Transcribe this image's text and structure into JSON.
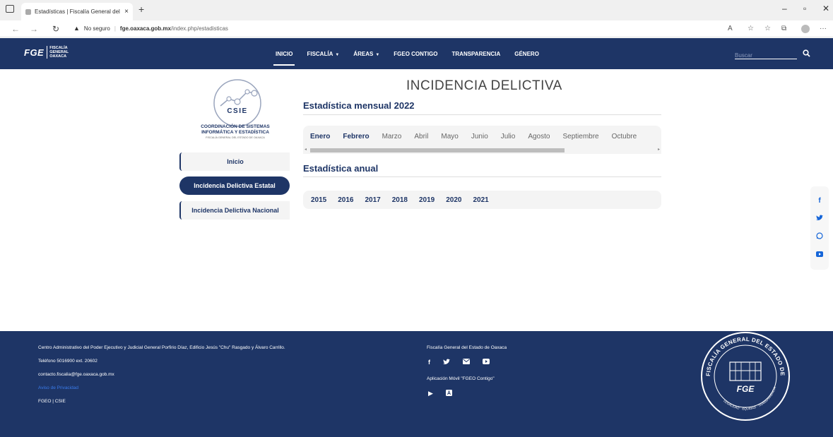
{
  "browser": {
    "tab_title": "Estadísticas | Fiscalía General del",
    "tab_close": "×",
    "new_tab": "+",
    "url_warning": "No seguro",
    "url_host": "fge.oaxaca.gob.mx",
    "url_path": "/index.php/estadisticas"
  },
  "header": {
    "logo_big": "FGE",
    "logo_small_1": "FISCALÍA",
    "logo_small_2": "GENERAL",
    "logo_small_3": "OAXACA",
    "nav": [
      {
        "label": "INICIO"
      },
      {
        "label": "FISCALÍA"
      },
      {
        "label": "ÁREAS"
      },
      {
        "label": "FGEO CONTIGO"
      },
      {
        "label": "TRANSPARENCIA"
      },
      {
        "label": "GÉNERO"
      }
    ],
    "search_placeholder": "Buscar"
  },
  "sidebar": {
    "logo_text": "CSIE",
    "title_1": "COORDINACIÓN DE SISTEMAS",
    "title_2": "INFORMÁTICA Y ESTADÍSTICA",
    "subtitle": "FISCALÍA GENERAL DEL ESTADO DE OAXACA",
    "items": [
      {
        "label": "Inicio"
      },
      {
        "label": "Incidencia Delictiva Estatal"
      },
      {
        "label": "Incidencia Delictiva Nacional"
      }
    ]
  },
  "main": {
    "title": "INCIDENCIA DELICTIVA",
    "monthly_title": "Estadística mensual 2022",
    "months": [
      "Enero",
      "Febrero",
      "Marzo",
      "Abril",
      "Mayo",
      "Junio",
      "Julio",
      "Agosto",
      "Septiembre",
      "Octubre"
    ],
    "annual_title": "Estadística anual",
    "years": [
      "2015",
      "2016",
      "2017",
      "2018",
      "2019",
      "2020",
      "2021"
    ]
  },
  "social": {
    "facebook": "f",
    "twitter": "🐦",
    "whatsapp": "☏",
    "youtube": "▶"
  },
  "footer": {
    "address": "Centro Administrativo del Poder Ejecutivo y Judicial General Porfirio Díaz, Edificio Jesús \"Chu\" Rasgado y Álvaro Carrillo.",
    "phone": "Teléfono 5016900 ext. 20602",
    "email": "contacto.fiscalia@fge.oaxaca.gob.mx",
    "privacy": "Aviso de Privacidad",
    "links": "FGEO | CSIE",
    "org": "Fiscalía General del Estado de Oaxaca",
    "app": "Aplicación Móvil \"FGEO Contigo\"",
    "seal_text": "FISCALÍA GENERAL DEL ESTADO DE OAXACA",
    "seal_motto": "LEGALIDAD · EQUIDAD · TRANSPARENCIA",
    "seal_logo": "FGE"
  }
}
